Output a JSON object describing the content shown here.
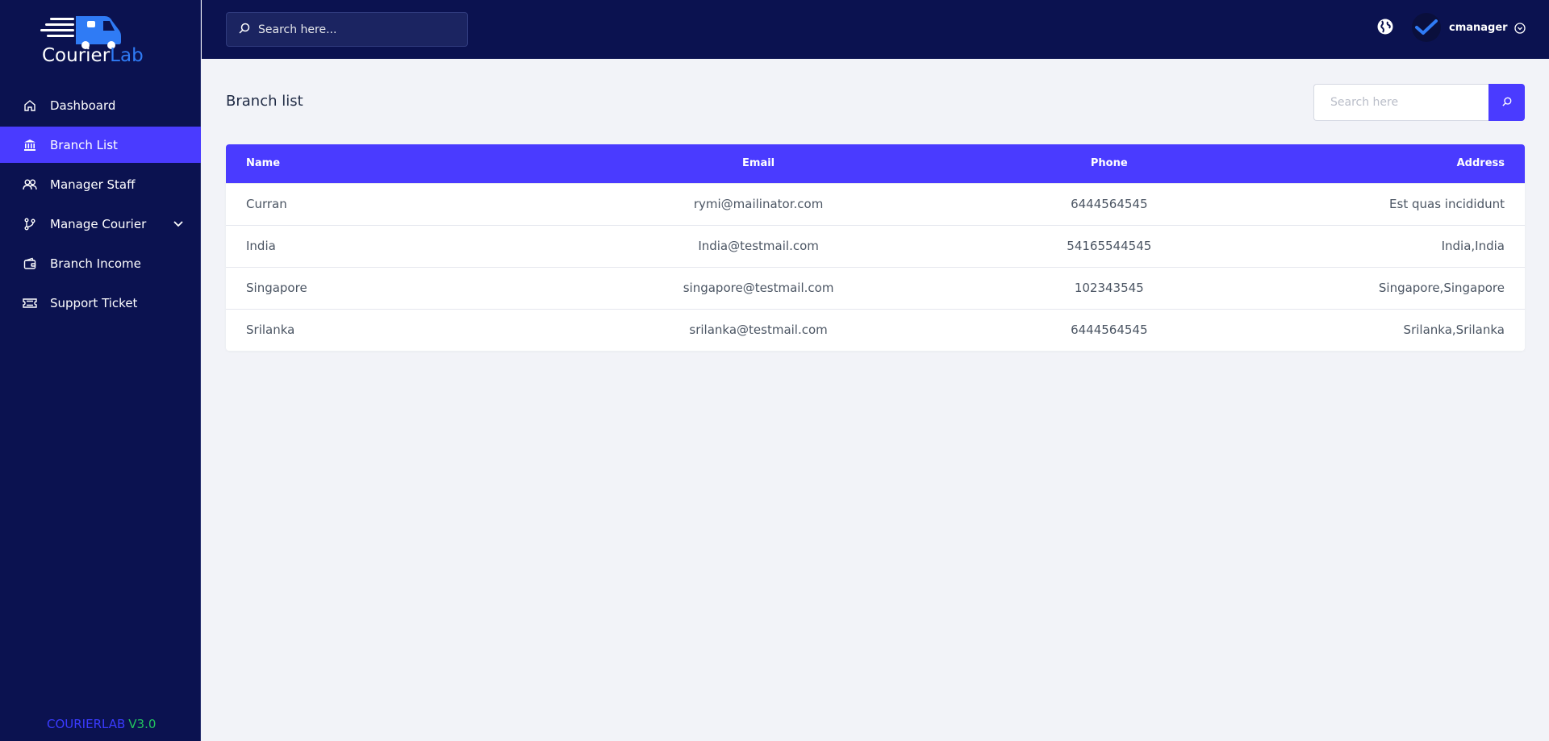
{
  "sidebar": {
    "logo": {
      "part1": "Courier",
      "part2": "Lab"
    },
    "items": [
      {
        "label": "Dashboard",
        "icon": "home-icon",
        "active": false
      },
      {
        "label": "Branch List",
        "icon": "bank-icon",
        "active": true
      },
      {
        "label": "Manager Staff",
        "icon": "users-icon",
        "active": false
      },
      {
        "label": "Manage Courier",
        "icon": "branch-icon",
        "active": false,
        "has_submenu": true
      },
      {
        "label": "Branch Income",
        "icon": "wallet-icon",
        "active": false
      },
      {
        "label": "Support Ticket",
        "icon": "ticket-icon",
        "active": false
      }
    ],
    "version": {
      "brand": "COURIERLAB",
      "number": "V3.0"
    }
  },
  "topbar": {
    "search_placeholder": "Search here...",
    "username": "cmanager"
  },
  "main": {
    "title": "Branch list",
    "search_placeholder": "Search here",
    "table": {
      "headers": [
        "Name",
        "Email",
        "Phone",
        "Address"
      ],
      "rows": [
        [
          "Curran",
          "rymi@mailinator.com",
          "6444564545",
          "Est quas incididunt"
        ],
        [
          "India",
          "India@testmail.com",
          "54165544545",
          "India,India"
        ],
        [
          "Singapore",
          "singapore@testmail.com",
          "102343545",
          "Singapore,Singapore"
        ],
        [
          "Srilanka",
          "srilanka@testmail.com",
          "6444564545",
          "Srilanka,Srilanka"
        ]
      ]
    }
  },
  "colors": {
    "sidebar_bg": "#0b1250",
    "accent": "#4a3bff",
    "content_bg": "#f2f3f8",
    "version_brand": "#3a3bff",
    "version_number": "#22c55e"
  }
}
